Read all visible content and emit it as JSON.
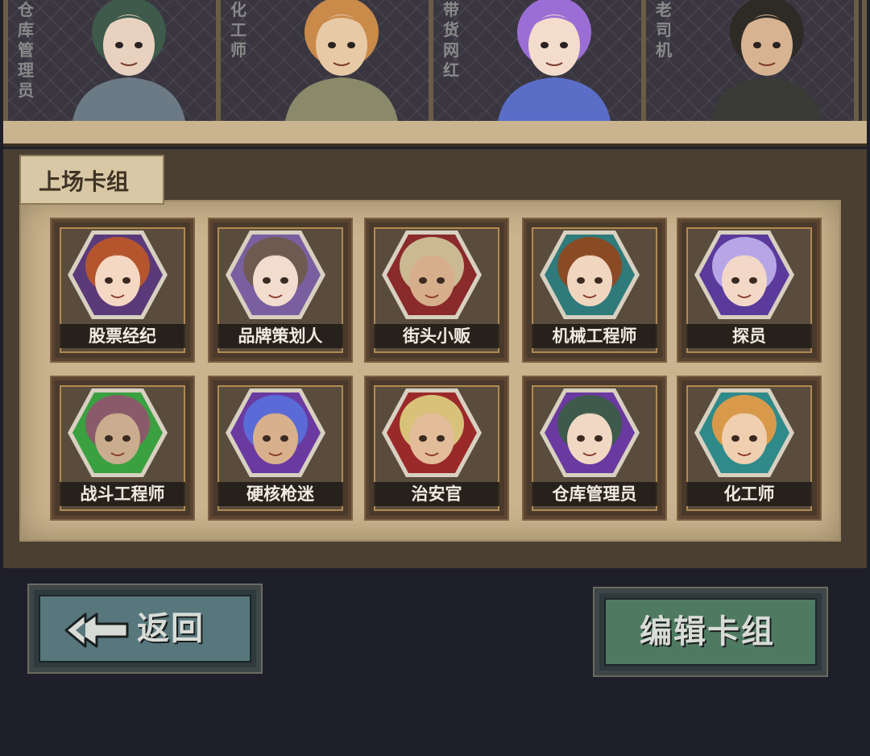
{
  "top_cards": [
    {
      "label": "仓库管理员",
      "portrait_icon": "warehouse-manager-portrait",
      "hair": "#3d5a4a",
      "skin": "#e8d2bf",
      "cloth": "#6c7a86"
    },
    {
      "label": "化工师",
      "portrait_icon": "chemist-portrait",
      "hair": "#c98a4a",
      "skin": "#e8c9a6",
      "cloth": "#8a8a6a"
    },
    {
      "label": "带货网红",
      "portrait_icon": "influencer-portrait",
      "hair": "#9b6ed6",
      "skin": "#f3dccb",
      "cloth": "#5a6ec8"
    },
    {
      "label": "老司机",
      "portrait_icon": "veteran-driver-portrait",
      "hair": "#2e2a26",
      "skin": "#d8b391",
      "cloth": "#3a3a36"
    }
  ],
  "deck": {
    "title": "上场卡组",
    "cards": [
      {
        "name": "股票经纪",
        "icon": "stockbroker-portrait",
        "hair": "#b5552e",
        "skin": "#f5d8c3",
        "bg": "#5b3a7a"
      },
      {
        "name": "品牌策划人",
        "icon": "brand-planner-portrait",
        "hair": "#6e5a50",
        "skin": "#f1dccd",
        "bg": "#7a5fa0"
      },
      {
        "name": "街头小贩",
        "icon": "street-vendor-portrait",
        "hair": "#cbb994",
        "skin": "#d7ae8c",
        "bg": "#8a2a2a"
      },
      {
        "name": "机械工程师",
        "icon": "mechanical-engineer-portrait",
        "hair": "#8a4a24",
        "skin": "#f0d5bf",
        "bg": "#2f7a7a"
      },
      {
        "name": "探员",
        "icon": "agent-portrait",
        "hair": "#b6a6e6",
        "skin": "#f3d8c8",
        "bg": "#5a3a9a"
      },
      {
        "name": "战斗工程师",
        "icon": "combat-engineer-portrait",
        "hair": "#8a5a6a",
        "skin": "#c9ad8e",
        "bg": "#3aa040"
      },
      {
        "name": "硬核枪迷",
        "icon": "hardcore-gun-fan-portrait",
        "hair": "#5a6ad6",
        "skin": "#d9b08c",
        "bg": "#6a3aa0"
      },
      {
        "name": "治安官",
        "icon": "sheriff-portrait",
        "hair": "#d8c27a",
        "skin": "#e3bc99",
        "bg": "#9a2a2a"
      },
      {
        "name": "仓库管理员",
        "icon": "warehouse-manager-portrait",
        "hair": "#3d5a4a",
        "skin": "#f0d8c4",
        "bg": "#6a3aa0"
      },
      {
        "name": "化工师",
        "icon": "chemist-portrait",
        "hair": "#d89a4a",
        "skin": "#efcfb0",
        "bg": "#2f8a8a"
      }
    ]
  },
  "buttons": {
    "back_label": "返回",
    "back_icon": "double-arrow-left-icon",
    "edit_label": "编辑卡组"
  }
}
